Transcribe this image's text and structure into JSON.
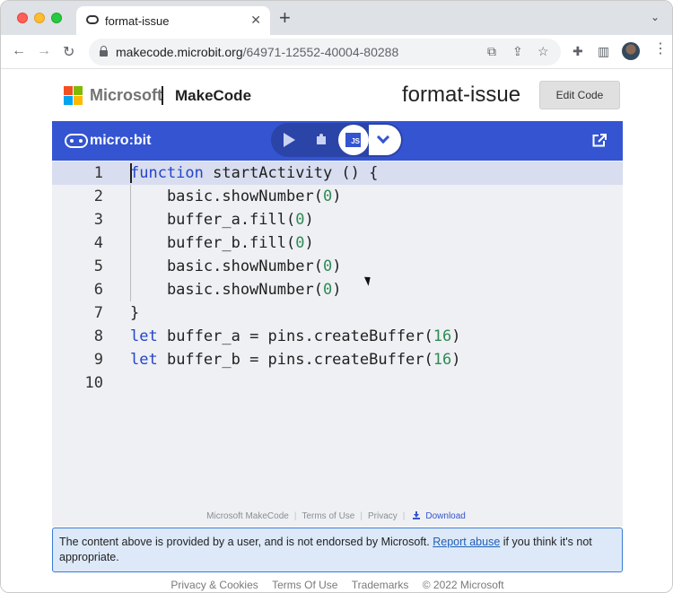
{
  "browser": {
    "tab_title": "format-issue",
    "new_tab": "+",
    "url_host": "makecode.microbit.org",
    "url_path": "/64971-12552-40004-80288"
  },
  "header": {
    "microsoft_label": "Microsoft",
    "makecode_label": "MakeCode",
    "project_title": "format-issue",
    "edit_code_label": "Edit Code"
  },
  "editor": {
    "brand": "micro:bit",
    "js_label": "JS",
    "lines": [
      {
        "n": "1",
        "html": [
          [
            "kw",
            "function"
          ],
          [
            "",
            "startActivity () {"
          ]
        ]
      },
      {
        "n": "2",
        "html": [
          [
            "",
            "    basic.showNumber("
          ],
          [
            "num",
            "0"
          ],
          [
            "",
            ")"
          ]
        ]
      },
      {
        "n": "3",
        "html": [
          [
            "",
            "    buffer_a.fill("
          ],
          [
            "num",
            "0"
          ],
          [
            "",
            ")"
          ]
        ]
      },
      {
        "n": "4",
        "html": [
          [
            "",
            "    buffer_b.fill("
          ],
          [
            "num",
            "0"
          ],
          [
            "",
            ")"
          ]
        ]
      },
      {
        "n": "5",
        "html": [
          [
            "",
            "    basic.showNumber("
          ],
          [
            "num",
            "0"
          ],
          [
            "",
            ")"
          ]
        ]
      },
      {
        "n": "6",
        "html": [
          [
            "",
            "    basic.showNumber("
          ],
          [
            "num",
            "0"
          ],
          [
            "",
            ")"
          ]
        ]
      },
      {
        "n": "7",
        "html": [
          [
            "",
            "}"
          ]
        ]
      },
      {
        "n": "8",
        "html": [
          [
            "kw",
            "let"
          ],
          [
            "",
            " buffer_a = pins.createBuffer("
          ],
          [
            "num",
            "16"
          ],
          [
            "",
            ")"
          ]
        ]
      },
      {
        "n": "9",
        "html": [
          [
            "kw",
            "let"
          ],
          [
            "",
            " buffer_b = pins.createBuffer("
          ],
          [
            "num",
            "16"
          ],
          [
            "",
            ")"
          ]
        ]
      },
      {
        "n": "10",
        "html": []
      }
    ]
  },
  "embed_footer": {
    "makecode": "Microsoft MakeCode",
    "terms": "Terms of Use",
    "privacy": "Privacy",
    "download": "Download"
  },
  "notice": {
    "text_before": "The content above is provided by a user, and is not endorsed by Microsoft.",
    "link": "Report abuse",
    "text_after": "if you think it's not appropriate."
  },
  "page_footer": {
    "privacy": "Privacy & Cookies",
    "terms": "Terms Of Use",
    "trademarks": "Trademarks",
    "copyright": "© 2022 Microsoft"
  },
  "colors": {
    "accent": "#3454d1",
    "keyword": "#2544c9",
    "number": "#2e8a55"
  }
}
